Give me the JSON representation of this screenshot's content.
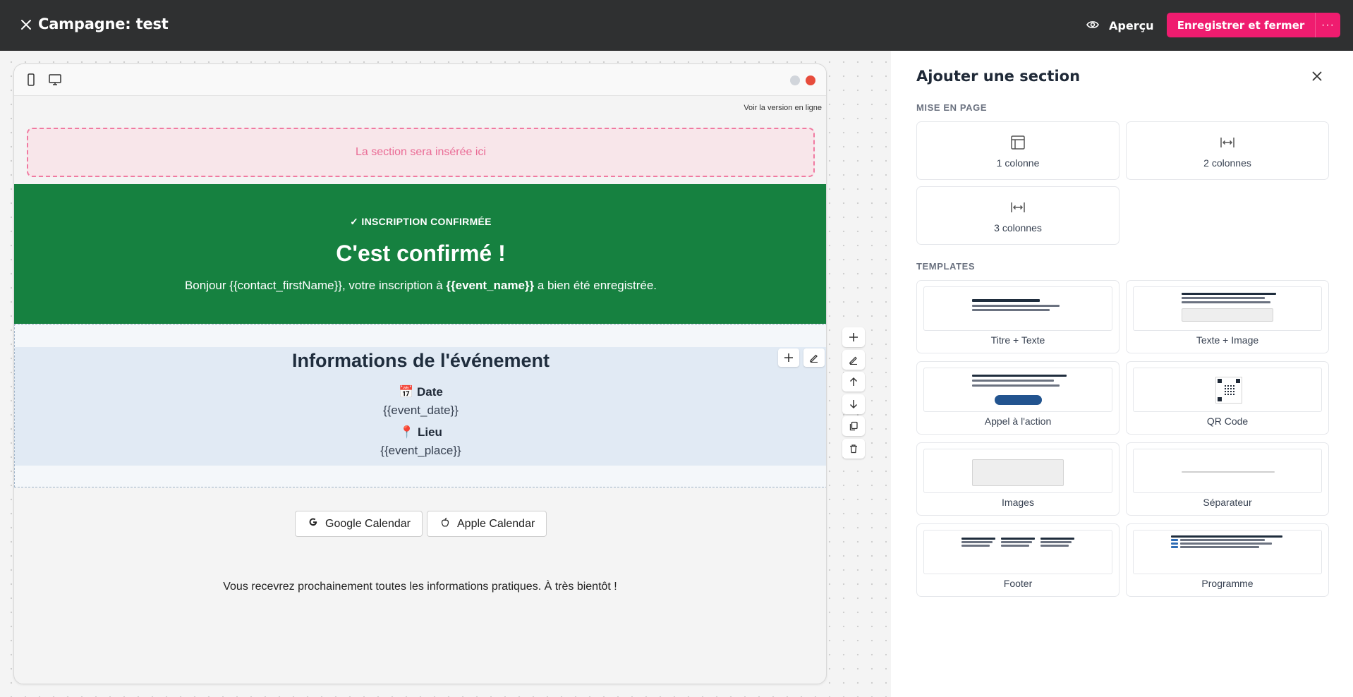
{
  "topbar": {
    "title": "Campagne: test",
    "preview_label": "Aperçu",
    "save_label": "Enregistrer et fermer",
    "more_label": "···",
    "icons": {
      "close": "close-icon",
      "preview": "eye-icon",
      "more": "more-horizontal-icon"
    },
    "colors": {
      "background": "#2f3031",
      "accent": "#ef1c6f"
    }
  },
  "editor": {
    "device_icons": [
      "mobile-icon",
      "desktop-icon"
    ],
    "status_dots": [
      "#d1d5db",
      "#e74c3c"
    ],
    "online_version_link": "Voir la version en ligne",
    "dropzone_text": "La section sera insérée ici",
    "hero": {
      "kicker": "✓ INSCRIPTION CONFIRMÉE",
      "title": "C'est confirmé !",
      "text_before": "Bonjour {{contact_firstName}}, votre inscription à ",
      "text_bold": "{{event_name}}",
      "text_after": " a bien été enregistrée.",
      "background": "#168140"
    },
    "info": {
      "title": "Informations de l'événement",
      "date_icon": "📅",
      "date_label": "Date",
      "date_value": "{{event_date}}",
      "place_icon": "📍",
      "place_label": "Lieu",
      "place_value": "{{event_place}}"
    },
    "calendar_buttons": {
      "google": "Google Calendar",
      "apple": "Apple Calendar"
    },
    "footer_text": "Vous recevrez prochainement toutes les informations pratiques. À très bientôt !",
    "section_tools": [
      "plus-icon",
      "edit-icon",
      "arrow-up-icon",
      "arrow-down-icon",
      "copy-icon",
      "trash-icon"
    ]
  },
  "panel": {
    "title": "Ajouter une section",
    "layout_heading": "MISE EN PAGE",
    "layouts": [
      "1 colonne",
      "2 colonnes",
      "3 colonnes"
    ],
    "templates_heading": "TEMPLATES",
    "templates": [
      "Titre + Texte",
      "Texte + Image",
      "Appel à l'action",
      "QR Code",
      "Images",
      "Séparateur",
      "Footer",
      "Programme"
    ]
  }
}
